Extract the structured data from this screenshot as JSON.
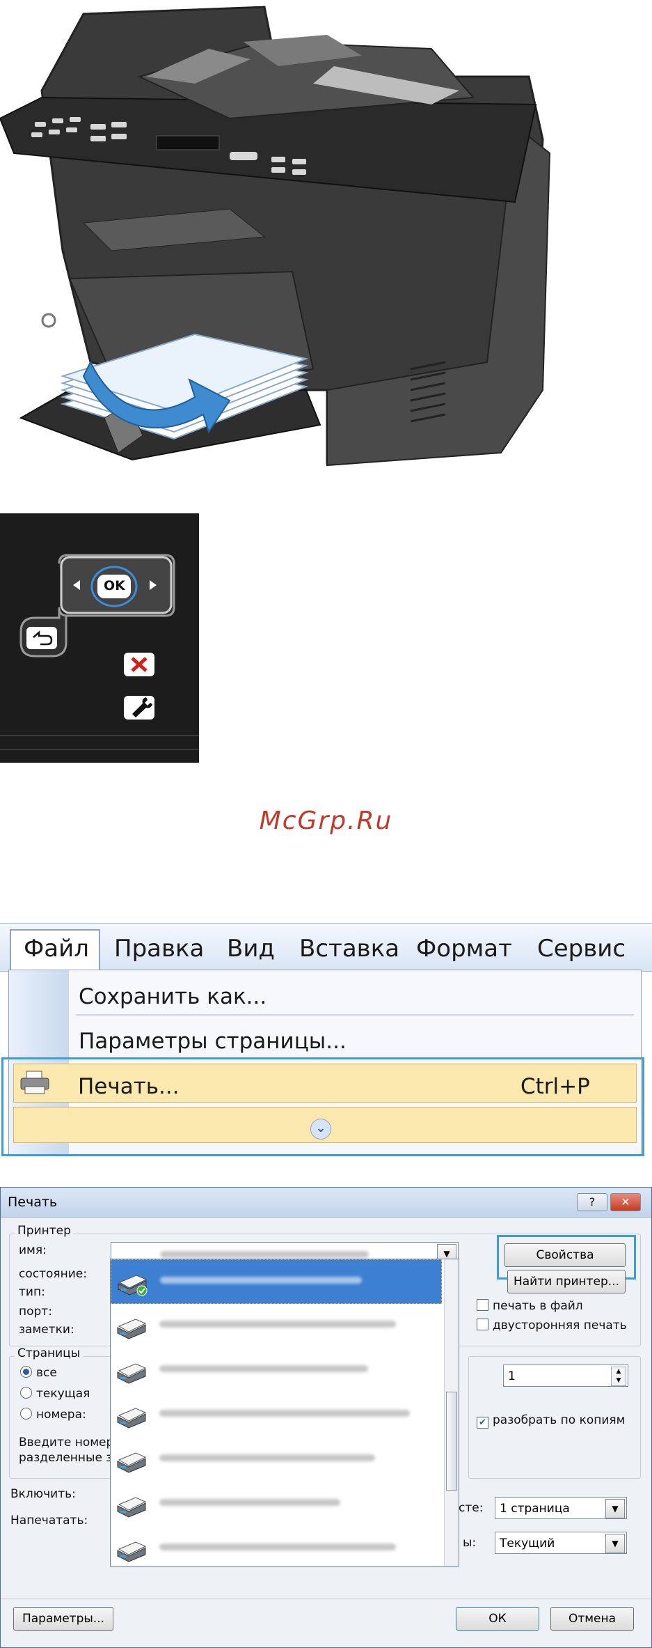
{
  "watermark": "McGrp.Ru",
  "panel": {
    "ok_label": "OK"
  },
  "menu": {
    "bar": [
      "Файл",
      "Правка",
      "Вид",
      "Вставка",
      "Формат",
      "Сервис"
    ],
    "items": {
      "save_as": "Сохранить как...",
      "page_setup": "Параметры страницы...",
      "print": "Печать...",
      "print_shortcut": "Ctrl+P"
    }
  },
  "dialog": {
    "title": "Печать",
    "title_help": "?",
    "title_close": "✕",
    "printer_group": "Принтер",
    "name_label": "имя:",
    "status_label": "состояние:",
    "type_label": "тип:",
    "port_label": "порт:",
    "notes_label": "заметки:",
    "properties_button": "Свойства",
    "find_printer_button": "Найти принтер...",
    "print_to_file": "печать в файл",
    "duplex": "двусторонняя печать",
    "pages_group": "Страницы",
    "radio_all": "все",
    "radio_current": "текущая",
    "radio_numbers": "номера:",
    "hint_line1": "Введите номер",
    "hint_line2": "разделенные з",
    "copies_value": "1",
    "collate": "разобрать по копиям",
    "include_label": "Включить:",
    "print_label": "Напечатать:",
    "pages_per_sheet_label": "сте:",
    "pages_per_sheet_value": "1 страница",
    "scale_label": "ы:",
    "scale_value": "Текущий",
    "options_button": "Параметры...",
    "ok_button": "ОК",
    "cancel_button": "Отмена",
    "printer_count": 7,
    "selected_printer_index": 0
  },
  "colors": {
    "watermark": "#c0392b",
    "highlight_frame": "#3d9dd4",
    "menu_hover": "#fbe8ae",
    "selection": "#3d7fd1"
  }
}
